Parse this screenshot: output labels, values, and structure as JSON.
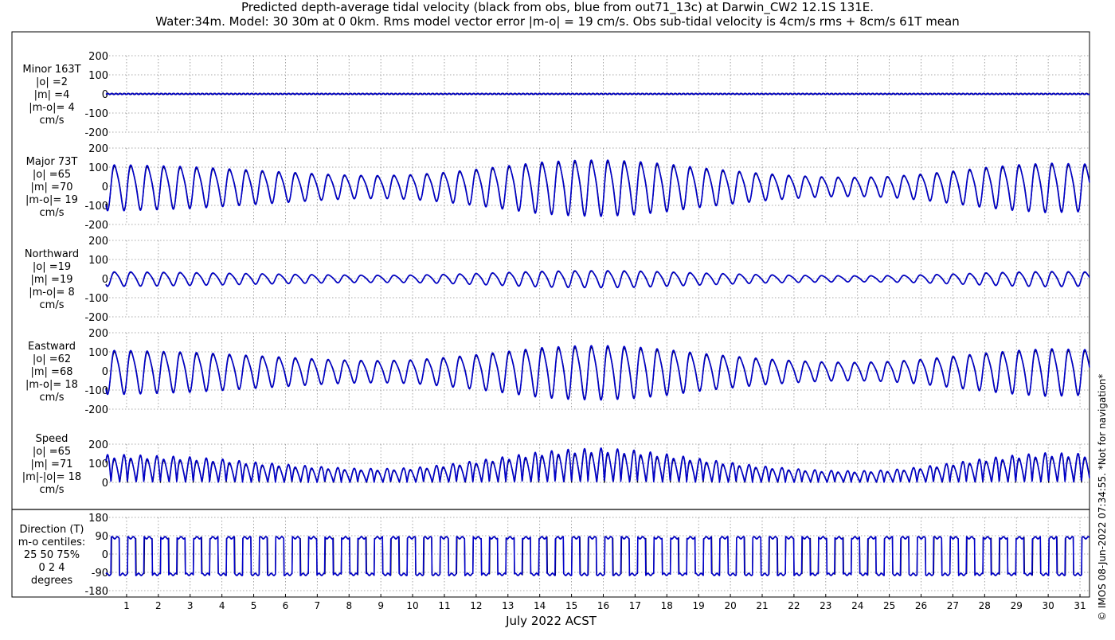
{
  "title": {
    "line1": "Predicted depth-average tidal velocity (black from obs, blue from out71_13c) at Darwin_CW2 12.1S 131E.",
    "line2": "Water:34m. Model: 30 30m at 0 0km. Rms model vector error |m-o| = 19 cm/s. Obs sub-tidal velocity is 4cm/s rms + 8cm/s 61T mean"
  },
  "xlabel": "July 2022 ACST",
  "watermark": "© IMOS 08-Jun-2022 07:34:55. *Not for navigation*",
  "colors": {
    "obs": "#000000",
    "model": "#0000cc",
    "grid": "#8c8c8c",
    "frame": "#000000"
  },
  "chart_data": [
    {
      "type": "line",
      "name": "minor",
      "x": [
        1,
        2,
        3,
        4,
        5,
        6,
        7,
        8,
        9,
        10,
        11,
        12,
        13,
        14,
        15,
        16,
        17,
        18,
        19,
        20,
        21,
        22,
        23,
        24,
        25,
        26,
        27,
        28,
        29,
        30,
        31
      ],
      "xlim": [
        0.35,
        31.3
      ],
      "ylim": [
        -200,
        200
      ],
      "yticks": [
        -200,
        -100,
        0,
        100,
        200
      ],
      "amplitude_by_day": [
        3,
        3,
        3,
        3,
        3,
        3,
        3,
        3,
        3,
        3,
        3,
        3,
        3,
        3,
        3,
        3,
        3,
        3,
        3,
        3,
        3,
        3,
        3,
        3,
        3,
        3,
        3,
        3,
        3,
        3,
        3
      ],
      "labels": [
        "Minor 163T",
        "|o| =2",
        "|m| =4",
        "|m-o|= 4",
        "cm/s"
      ],
      "series": [
        {
          "name": "obs",
          "color": "#000000"
        },
        {
          "name": "model",
          "color": "#0000cc"
        }
      ]
    },
    {
      "type": "line",
      "name": "major",
      "x": [
        1,
        2,
        3,
        4,
        5,
        6,
        7,
        8,
        9,
        10,
        11,
        12,
        13,
        14,
        15,
        16,
        17,
        18,
        19,
        20,
        21,
        22,
        23,
        24,
        25,
        26,
        27,
        28,
        29,
        30,
        31
      ],
      "xlim": [
        0.35,
        31.3
      ],
      "ylim": [
        -200,
        200
      ],
      "yticks": [
        -200,
        -100,
        0,
        100,
        200
      ],
      "amplitude_by_day": [
        120,
        115,
        110,
        100,
        90,
        80,
        70,
        62,
        60,
        65,
        78,
        95,
        115,
        135,
        145,
        148,
        140,
        125,
        105,
        88,
        72,
        60,
        52,
        50,
        55,
        68,
        85,
        105,
        120,
        130,
        125
      ],
      "labels": [
        "Major 73T",
        "|o| =65",
        "|m| =70",
        "|m-o|= 19",
        "cm/s"
      ],
      "series": [
        {
          "name": "obs",
          "color": "#000000"
        },
        {
          "name": "model",
          "color": "#0000cc"
        }
      ]
    },
    {
      "type": "line",
      "name": "northward",
      "x": [
        1,
        2,
        3,
        4,
        5,
        6,
        7,
        8,
        9,
        10,
        11,
        12,
        13,
        14,
        15,
        16,
        17,
        18,
        19,
        20,
        21,
        22,
        23,
        24,
        25,
        26,
        27,
        28,
        29,
        30,
        31
      ],
      "xlim": [
        0.35,
        31.3
      ],
      "ylim": [
        -200,
        200
      ],
      "yticks": [
        -200,
        -100,
        0,
        100,
        200
      ],
      "amplitude_by_day": [
        38,
        36,
        34,
        31,
        28,
        25,
        22,
        20,
        19,
        20,
        24,
        29,
        35,
        41,
        44,
        45,
        43,
        38,
        32,
        27,
        22,
        19,
        17,
        16,
        17,
        21,
        26,
        32,
        37,
        40,
        38
      ],
      "labels": [
        "Northward",
        "|o| =19",
        "|m| =19",
        "|m-o|= 8",
        "cm/s"
      ],
      "series": [
        {
          "name": "obs",
          "color": "#000000"
        },
        {
          "name": "model",
          "color": "#0000cc"
        }
      ]
    },
    {
      "type": "line",
      "name": "eastward",
      "x": [
        1,
        2,
        3,
        4,
        5,
        6,
        7,
        8,
        9,
        10,
        11,
        12,
        13,
        14,
        15,
        16,
        17,
        18,
        19,
        20,
        21,
        22,
        23,
        24,
        25,
        26,
        27,
        28,
        29,
        30,
        31
      ],
      "xlim": [
        0.35,
        31.3
      ],
      "ylim": [
        -200,
        200
      ],
      "yticks": [
        -200,
        -100,
        0,
        100,
        200
      ],
      "amplitude_by_day": [
        115,
        110,
        105,
        96,
        86,
        77,
        67,
        60,
        58,
        62,
        75,
        91,
        110,
        130,
        140,
        143,
        135,
        120,
        100,
        84,
        69,
        58,
        50,
        48,
        53,
        65,
        82,
        100,
        115,
        125,
        120
      ],
      "labels": [
        "Eastward",
        "|o| =62",
        "|m| =68",
        "|m-o|= 18",
        "cm/s"
      ],
      "series": [
        {
          "name": "obs",
          "color": "#000000"
        },
        {
          "name": "model",
          "color": "#0000cc"
        }
      ]
    },
    {
      "type": "line",
      "name": "speed",
      "x": [
        1,
        2,
        3,
        4,
        5,
        6,
        7,
        8,
        9,
        10,
        11,
        12,
        13,
        14,
        15,
        16,
        17,
        18,
        19,
        20,
        21,
        22,
        23,
        24,
        25,
        26,
        27,
        28,
        29,
        30,
        31
      ],
      "xlim": [
        0.35,
        31.3
      ],
      "ylim": [
        0,
        200
      ],
      "yticks": [
        0,
        100,
        200
      ],
      "amplitude_by_day": [
        125,
        120,
        115,
        105,
        92,
        82,
        72,
        64,
        62,
        66,
        80,
        98,
        118,
        138,
        150,
        155,
        145,
        128,
        108,
        90,
        74,
        62,
        54,
        52,
        56,
        70,
        88,
        108,
        124,
        134,
        130
      ],
      "labels": [
        "Speed",
        "|o| =65",
        "|m| =71",
        "|m|-|o|= 18",
        "cm/s"
      ],
      "series": [
        {
          "name": "obs",
          "color": "#000000"
        },
        {
          "name": "model",
          "color": "#0000cc"
        }
      ]
    },
    {
      "type": "line",
      "name": "direction",
      "x": [
        1,
        2,
        3,
        4,
        5,
        6,
        7,
        8,
        9,
        10,
        11,
        12,
        13,
        14,
        15,
        16,
        17,
        18,
        19,
        20,
        21,
        22,
        23,
        24,
        25,
        26,
        27,
        28,
        29,
        30,
        31
      ],
      "xlim": [
        0.35,
        31.3
      ],
      "ylim": [
        -180,
        180
      ],
      "yticks": [
        -180,
        -90,
        0,
        90,
        180
      ],
      "flood_direction": 80,
      "ebb_direction": -100,
      "labels": [
        "Direction (T)",
        "m-o centiles:",
        "25  50  75%",
        "0   2   4",
        "degrees"
      ],
      "series": [
        {
          "name": "obs",
          "color": "#000000"
        },
        {
          "name": "model",
          "color": "#0000cc"
        }
      ]
    }
  ]
}
